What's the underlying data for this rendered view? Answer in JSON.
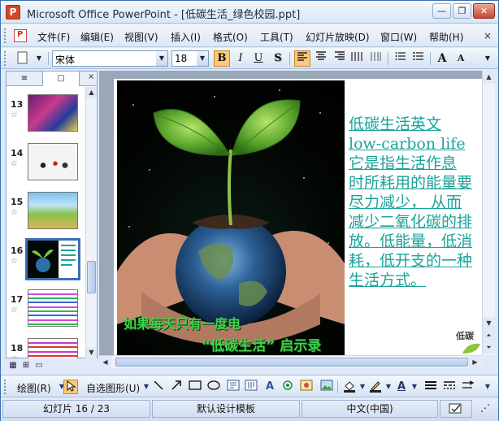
{
  "window": {
    "title": "Microsoft Office PowerPoint - [低碳生活_绿色校园.ppt]",
    "app_icon_letter": "P",
    "minimize": "—",
    "restore": "❐",
    "close": "✕"
  },
  "menu": {
    "items": [
      "文件(F)",
      "编辑(E)",
      "视图(V)",
      "插入(I)",
      "格式(O)",
      "工具(T)",
      "幻灯片放映(D)",
      "窗口(W)",
      "帮助(H)"
    ],
    "close_glyph": "×"
  },
  "format_toolbar": {
    "font_name": "宋体",
    "font_size": "18",
    "bold": "B",
    "italic": "I",
    "underline": "U",
    "shadow": "S",
    "grow_font": "A",
    "shrink_font": "A"
  },
  "slide_panel": {
    "tab_outline": "≡",
    "tab_slides": "▢",
    "close_glyph": "×",
    "thumbnails": [
      {
        "number": "13",
        "star": "☆"
      },
      {
        "number": "14",
        "star": "☆"
      },
      {
        "number": "15",
        "star": "☆"
      },
      {
        "number": "16",
        "star": "☆",
        "selected": true
      },
      {
        "number": "17",
        "star": "☆"
      },
      {
        "number": "18",
        "star": "☆"
      }
    ]
  },
  "slide": {
    "caption_line1": "如果每天只有一度电",
    "caption_line2": "“低碳生活” 启示录",
    "text_lines": [
      "  低碳生活英文",
      "low-carbon life",
      "  它是指生活作息",
      "时所耗用的能量要",
      "尽力减少，  从而",
      "减少二氧化碳的排",
      "放。低能量，低消",
      "耗，低开支的一种",
      "生活方式。"
    ],
    "logo_text": "低碳"
  },
  "draw_toolbar": {
    "draw_label": "绘图(R)",
    "autoshapes_label": "自选图形(U)"
  },
  "status_bar": {
    "slide_position": "幻灯片 16 / 23",
    "design_template": "默认设计模板",
    "language": "中文(中国)"
  },
  "colors": {
    "slide_text": "#1aa39a",
    "caption_green": "#3fd24a",
    "selection_border": "#3a6fb8",
    "active_button": "#ffc77a"
  }
}
